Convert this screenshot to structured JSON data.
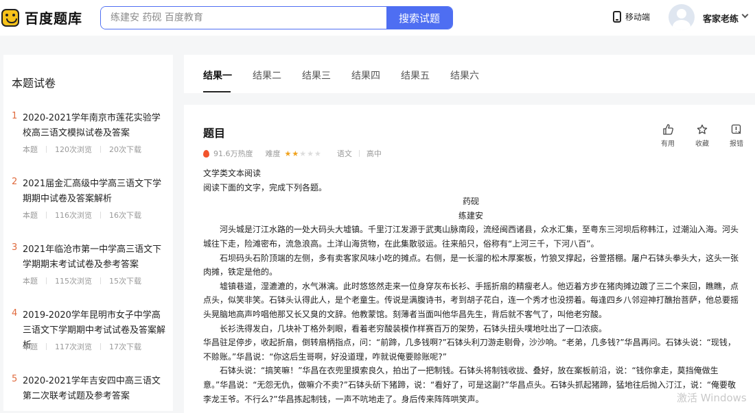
{
  "header": {
    "logo_text": "百度题库",
    "search_placeholder": "练建安 药砚 百度教育",
    "search_button": "搜索试题",
    "mobile_label": "移动端",
    "username": "客家老练"
  },
  "sidebar": {
    "title": "本题试卷",
    "papers": [
      {
        "num": "1",
        "title": "2020-2021学年南京市莲花实验学校高三语文模拟试卷及答案",
        "tag": "本题",
        "views": "120次浏览",
        "downloads": "20次下载"
      },
      {
        "num": "2",
        "title": "2021届金汇高级中学高三语文下学期期中试卷及答案解析",
        "tag": "本题",
        "views": "116次浏览",
        "downloads": "16次下载"
      },
      {
        "num": "3",
        "title": "2021年临沧市第一中学高三语文下学期期末考试试卷及参考答案",
        "tag": "本题",
        "views": "115次浏览",
        "downloads": "15次下载"
      },
      {
        "num": "4",
        "title": "2019-2020学年昆明市女子中学高三语文下学期期中考试试卷及答案解析",
        "tag": "本题",
        "views": "117次浏览",
        "downloads": "17次下载"
      },
      {
        "num": "5",
        "title": "2020-2021学年吉安四中高三语文第二次联考试题及参考答案",
        "tag": "",
        "views": "",
        "downloads": ""
      }
    ]
  },
  "tabs": [
    "结果一",
    "结果二",
    "结果三",
    "结果四",
    "结果五",
    "结果六"
  ],
  "question": {
    "title": "题目",
    "heat": "91.6万热度",
    "difficulty_label": "难度",
    "difficulty_stars": 2,
    "subject": "语文",
    "level": "高中",
    "actions": {
      "useful": "有用",
      "favorite": "收藏",
      "report": "报错"
    },
    "lines": [
      "文学类文本阅读",
      "阅读下面的文字，完成下列各题。",
      "药砚",
      "练建安",
      "　　河头城是汀江水路的一处大码头大墟镇。千里汀江发源于武夷山脉南段，流经闽西诸县，众水汇集，至粤东三河坝后称韩江，过潮汕入海。河头城往下走，险滩密布，流急浪高。土洋山海货物，在此集散驳运。往来船只，俗称有“上河三千，下河八百”。",
      "　　石坝码头石阶顶端的左侧，多有卖客家风味小吃的摊点。右侧，是一长溜的松木厚案板，竹狼叉撑起，谷萱搭棚。屠户石钵头拳头大，这头一张肉摊，铁定是他的。",
      "　　墟镇巷道，湿漉漉的，水气淋漓。此时悠悠然走来一位身穿灰布长衫、手摇折扇的精瘦老人。他迈着方步在猪肉摊边踱了三二个来回，瞧瞧，点点头，似笑非笑。石钵头认得此人，是个老童生。传说是满腹诗书，考到胡子花白，连一个秀才也没捞着。每逢四乡八邻迎神打醮抬菩萨，他总要摇头晃脑地高声吟唱他那又长又臭的文辞。他教蒙馆。刻薄者当面叫他华昌先生，背后就不客气了，叫他老穷酸。",
      "　　长衫洗得发白，几块补丁格外刺眼，看着老穷酸装模作样赛百万的架势，石钵头扭头噗地吐出了一口浓痰。",
      "华昌驻足停步，收起折扇，倒转扇柄指点，问：“前蹄，几多钱啊?”石钵头利刀游走剔骨，沙沙响。“老弟，几多钱?”华昌再问。石钵头说：“现钱，不赊账。”华昌说：“你这后生哥啊，好没道理，咋就说俺要赊账呢?”",
      "　　石钵头说：“搞笑嘛！”华昌在衣兜里摸索良久，拍出了一把制钱。石钵头将制钱收拢、叠好，放在案板前沿，说：“钱你拿走，莫挡俺做生意。”华昌说：“无怨无仇，做嘛介不卖?”石钵头斫下猪蹄，说：“看好了，可是这副?”华昌点头。石钵头抓起猪蹄，猛地往后抛入汀江，说：“俺要敬李龙王爷。不行么?”华昌拣起制钱，一声不吭地走了。身后传来阵阵哄笑声。"
    ]
  },
  "watermark": "激活 Windows"
}
